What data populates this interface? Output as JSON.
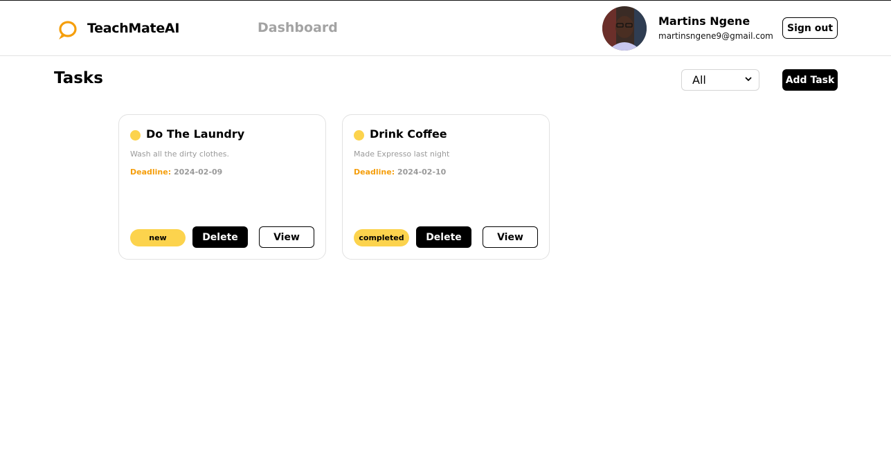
{
  "header": {
    "brand": "TeachMateAI",
    "nav_dashboard": "Dashboard",
    "user": {
      "name": "Martins Ngene",
      "email": "martinsngene9@gmail.com"
    },
    "sign_out": "Sign out",
    "logo_icon": "chat-bubble-icon",
    "brand_color": "#f59e0b"
  },
  "page": {
    "title": "Tasks",
    "filter_value": "All",
    "add_task": "Add Task"
  },
  "tasks": [
    {
      "title": "Do The Laundry",
      "description": "Wash all the dirty clothes.",
      "deadline_label": "Deadline:",
      "deadline": "2024-02-09",
      "status": "new",
      "delete_label": "Delete",
      "view_label": "View"
    },
    {
      "title": "Drink Coffee",
      "description": "Made Expresso last night",
      "deadline_label": "Deadline:",
      "deadline": "2024-02-10",
      "status": "completed",
      "delete_label": "Delete",
      "view_label": "View"
    }
  ],
  "colors": {
    "status_yellow": "#fcd34d",
    "deadline_orange": "#f59e0b",
    "muted_gray": "#9a9a9a"
  }
}
